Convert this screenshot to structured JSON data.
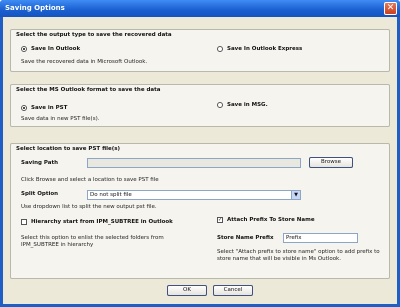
{
  "window": {
    "title": "Saving Options"
  },
  "output_type": {
    "heading": "Select the output type to save the recovered data",
    "options": [
      {
        "label": "Save In Outlook",
        "selected": true
      },
      {
        "label": "Save In Outlook Express",
        "selected": false
      }
    ],
    "description": "Save the recovered data in Microsoft Outlook."
  },
  "format": {
    "heading": "Select the MS Outlook format to save the data",
    "options": [
      {
        "label": "Save in PST",
        "selected": true
      },
      {
        "label": "Save in MSG.",
        "selected": false
      }
    ],
    "description": "Save data in new PST file(s)."
  },
  "location": {
    "heading": "Select location to save PST file(s)",
    "saving_path_label": "Saving Path",
    "saving_path_value": "",
    "browse_label": "Browse",
    "browse_help": "Click Browse and select a location to save PST file",
    "split_option_label": "Split Option",
    "split_option_value": "Do not split file",
    "split_help": "Use dropdown list to split the new output pst file.",
    "hierarchy_label": "Hierarchy start from IPM_SUBTREE in Outlook",
    "hierarchy_checked": false,
    "hierarchy_help": "Select this option to enlist the selected folders from IPM_SUBTREE in hierarchy",
    "attach_prefix_label": "Attach Prefix To Store Name",
    "attach_prefix_checked": true,
    "store_name_prefix_label": "Store Name Prefix",
    "store_name_prefix_value": "Prefix",
    "prefix_help": "Select \"Attach prefix to store name\" option to add prefix to store name that will be visible in Ms Outlook."
  },
  "buttons": {
    "ok": "OK",
    "cancel": "Cancel"
  }
}
